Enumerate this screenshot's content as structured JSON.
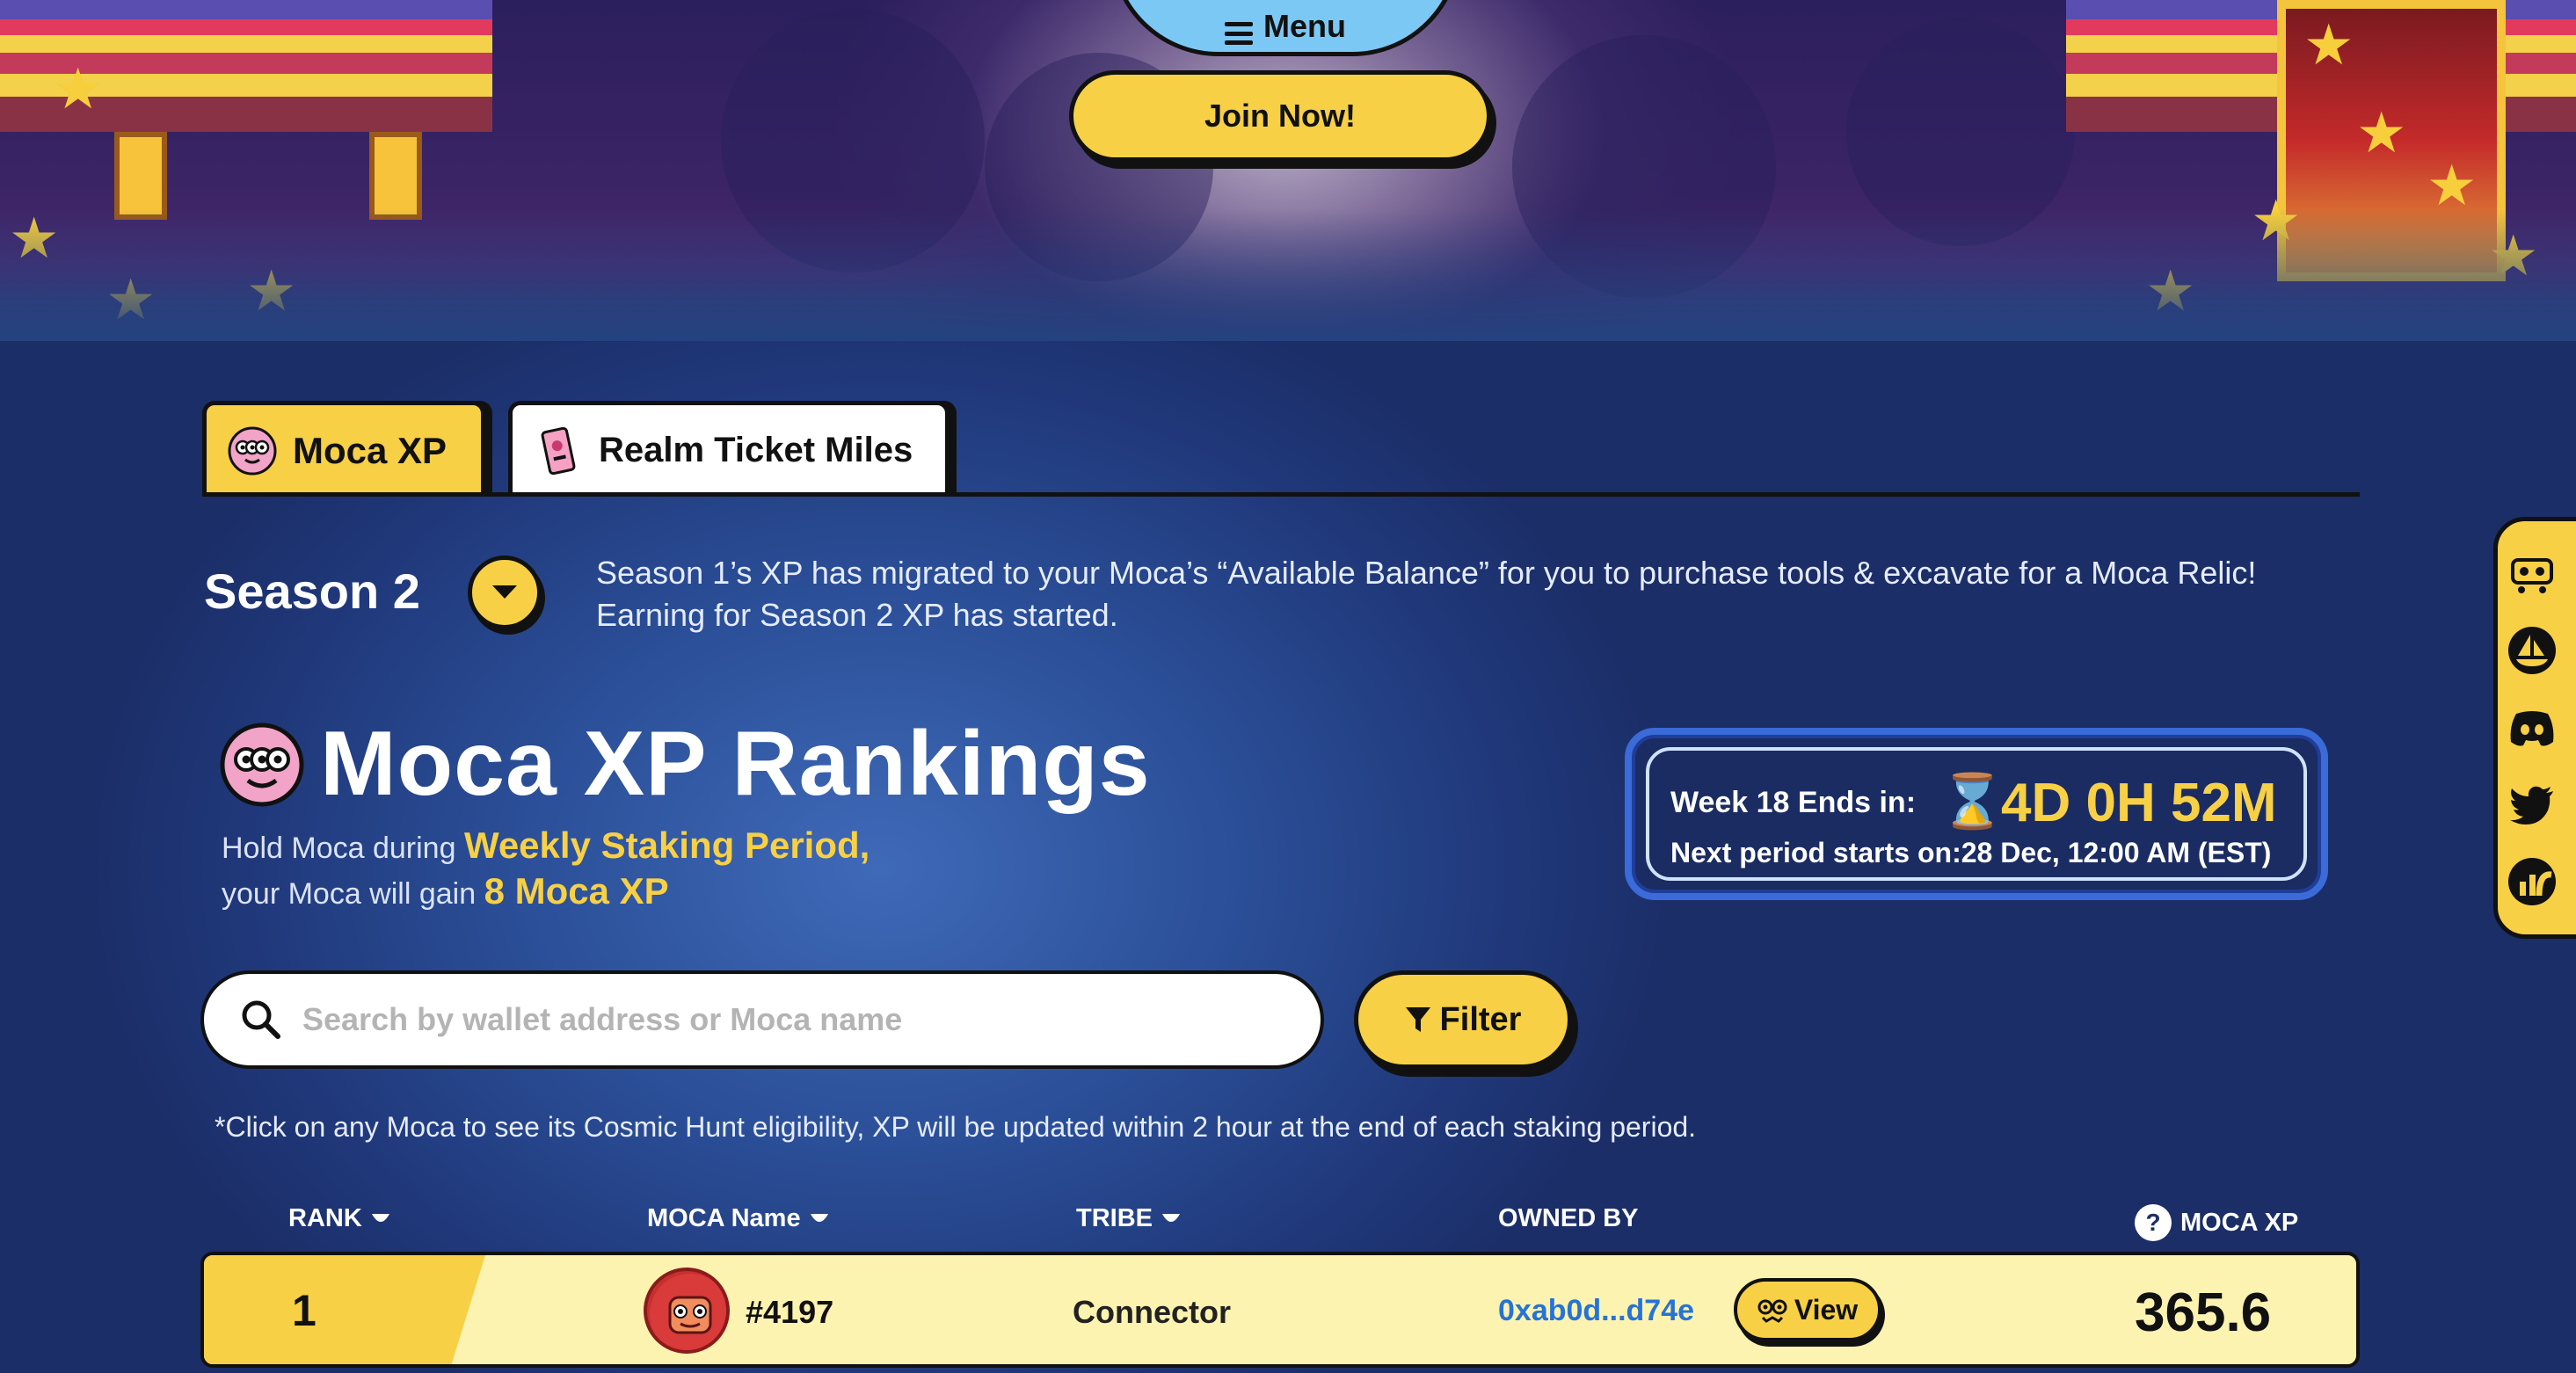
{
  "header": {
    "menu_label": "Menu",
    "join_label": "Join Now!"
  },
  "tabs": [
    {
      "label": "Moca XP",
      "active": true
    },
    {
      "label": "Realm Ticket Miles",
      "active": false
    }
  ],
  "season": {
    "title": "Season 2",
    "note_line1": "Season 1’s XP has migrated to your Moca’s “Available Balance” for you to purchase tools & excavate for a Moca Relic!",
    "note_line2": "Earning for Season 2 XP has started."
  },
  "rankings": {
    "title": "Moca XP Rankings",
    "hold_prefix": "Hold Moca during",
    "hold_period": "Weekly Staking Period,",
    "gain_prefix": "your Moca will gain",
    "gain_amount": "8 Moca XP"
  },
  "timer": {
    "week_label": "Week 18 Ends in:",
    "countdown": "4D 0H 52M",
    "next_period": "Next period starts on:28 Dec, 12:00 AM (EST)"
  },
  "search": {
    "placeholder": "Search by wallet address or Moca name",
    "value": ""
  },
  "filter_label": "Filter",
  "disclaimer": "*Click on any Moca to see its Cosmic Hunt eligibility, XP will be updated within 2 hour at the end of each staking period.",
  "table": {
    "columns": [
      "RANK",
      "MOCA Name",
      "TRIBE",
      "OWNED BY",
      "MOCA XP"
    ],
    "help_glyph": "?",
    "rows": [
      {
        "rank": "1",
        "moca": "#4197",
        "tribe": "Connector",
        "owner": "0xab0d...d74e",
        "view": "View",
        "xp": "365.6"
      }
    ]
  },
  "social": [
    "marketplace-icon",
    "opensea-icon",
    "discord-icon",
    "twitter-icon",
    "chart-icon"
  ],
  "colors": {
    "accent_yellow": "#f7d046",
    "background_blue": "#24427f",
    "link_blue": "#2673d6",
    "row_bg": "#fcf3b0"
  }
}
